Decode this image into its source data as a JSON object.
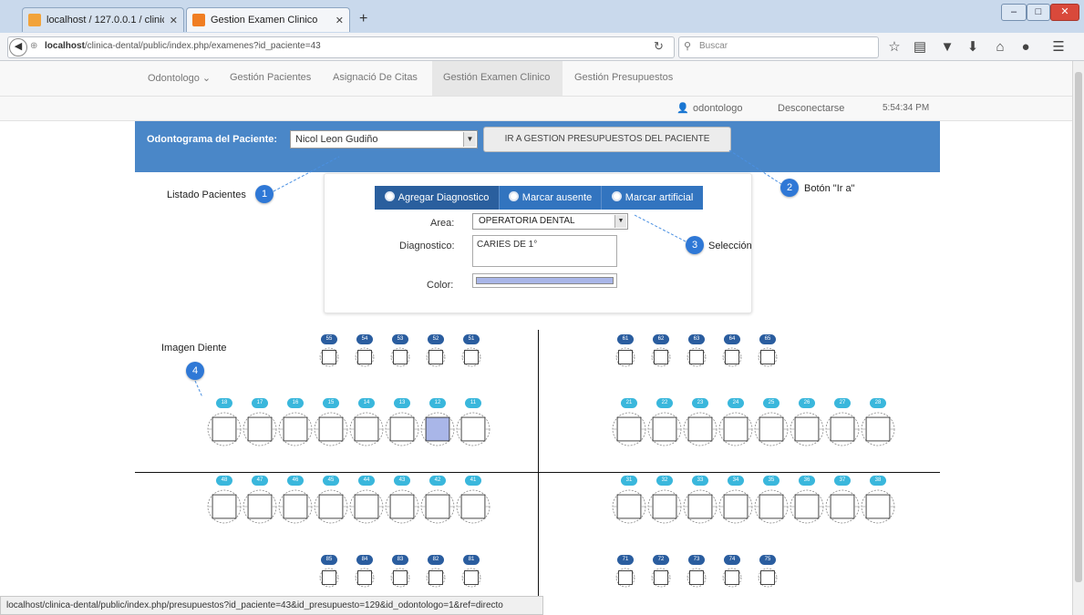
{
  "browser": {
    "tabs": [
      {
        "label": "localhost / 127.0.0.1 / clinic...",
        "icon": "phpmyadmin-icon",
        "color": "#f2a33a"
      },
      {
        "label": "Gestion Examen Clinico",
        "icon": "app-icon",
        "color": "#f07e22"
      }
    ],
    "new_tab": "+",
    "url_host": "localhost",
    "url_path": "/clinica-dental/public/index.php/examenes?id_paciente=43",
    "search_placeholder": "Buscar",
    "status_url": "localhost/clinica-dental/public/index.php/presupuestos?id_paciente=43&id_presupuesto=129&id_odontologo=1&ref=directo"
  },
  "nav": {
    "items": [
      "Odontologo ⌄",
      "Gestión Pacientes",
      "Asignació De Citas",
      "Gestión Examen Clinico",
      "Gestión Presupuestos"
    ],
    "user": "odontologo",
    "logout": "Desconectarse",
    "time": "5:54:34 PM"
  },
  "header": {
    "title": "Odontograma del Paciente:",
    "patient": "Nicol Leon Gudiño",
    "go_button": "IR A GESTION PRESUPUESTOS DEL PACIENTE"
  },
  "panel": {
    "segments": [
      "Agregar Diagnostico",
      "Marcar ausente",
      "Marcar artificial"
    ],
    "area_label": "Area:",
    "area_value": "OPERATORIA DENTAL",
    "diag_label": "Diagnostico:",
    "diag_value": "CARIES DE 1°",
    "color_label": "Color:",
    "color_value": "#a9b6e8"
  },
  "callouts": [
    {
      "num": "1",
      "text": "Listado Pacientes"
    },
    {
      "num": "2",
      "text": "Botón \"Ir a\""
    },
    {
      "num": "3",
      "text": "Selección"
    },
    {
      "num": "4",
      "text": "Imagen Diente"
    }
  ],
  "teeth": {
    "upper_left_small": [
      "55",
      "54",
      "53",
      "52",
      "51"
    ],
    "upper_right_small": [
      "61",
      "62",
      "63",
      "64",
      "65"
    ],
    "upper_left": [
      "18",
      "17",
      "16",
      "15",
      "14",
      "13",
      "12",
      "11"
    ],
    "upper_right": [
      "21",
      "22",
      "23",
      "24",
      "25",
      "26",
      "27",
      "28"
    ],
    "lower_left": [
      "48",
      "47",
      "46",
      "45",
      "44",
      "43",
      "42",
      "41"
    ],
    "lower_right": [
      "31",
      "32",
      "33",
      "34",
      "35",
      "36",
      "37",
      "38"
    ],
    "lower_left_small": [
      "85",
      "84",
      "83",
      "82",
      "81"
    ],
    "lower_right_small": [
      "71",
      "72",
      "73",
      "74",
      "75"
    ],
    "marked_tooth": "12",
    "marked_color": "#a9b6e8"
  }
}
